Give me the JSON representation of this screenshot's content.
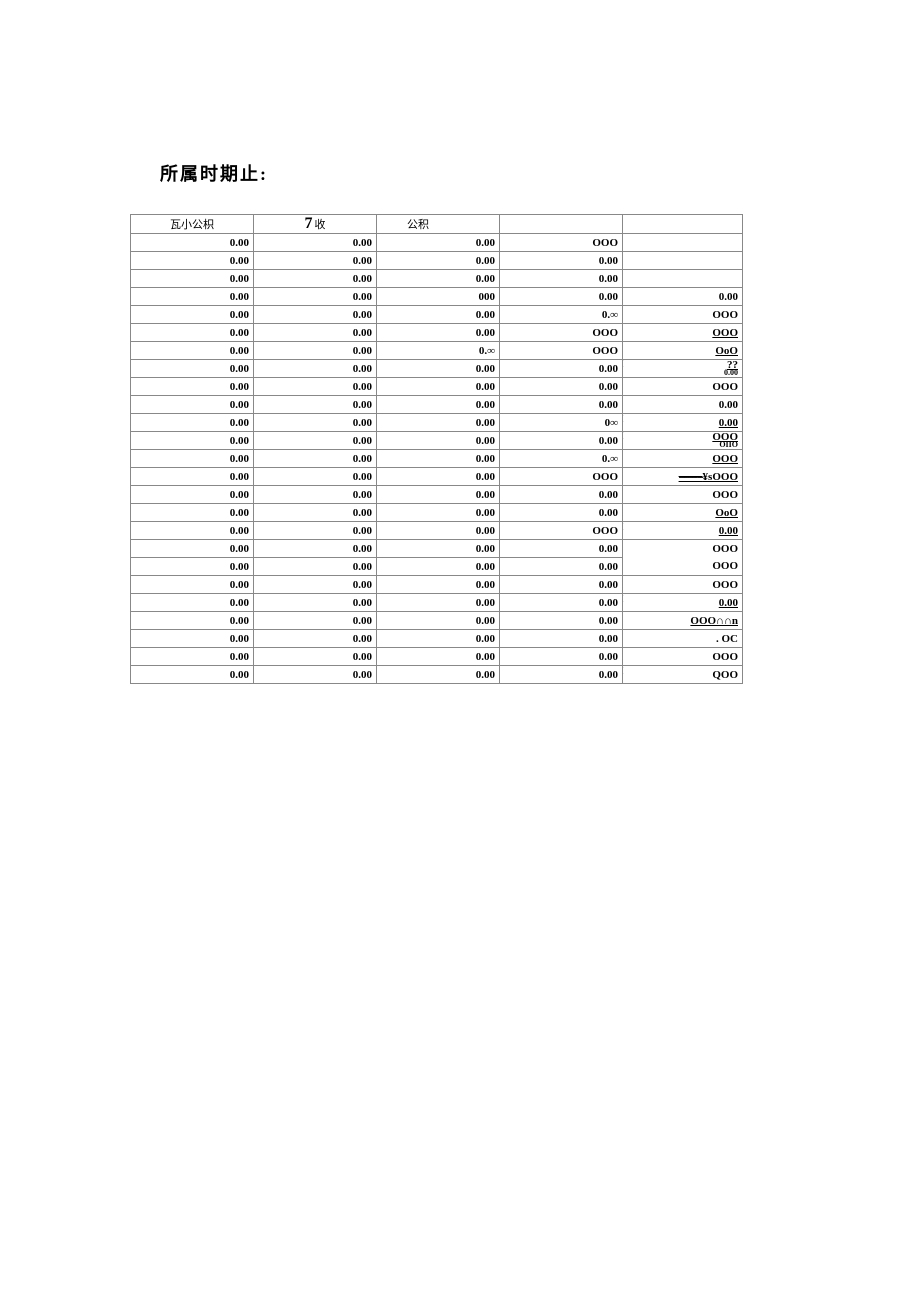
{
  "title": "所属时期止:",
  "headers": [
    "瓦小公枳",
    "7",
    "收",
    "公积",
    "",
    ""
  ],
  "rows": [
    [
      "0.00",
      "0.00",
      "0.00",
      "OOO",
      ""
    ],
    [
      "0.00",
      "0.00",
      "0.00",
      "0.00",
      ""
    ],
    [
      "0.00",
      "0.00",
      "0.00",
      "0.00",
      ""
    ],
    [
      "0.00",
      "0.00",
      "000",
      "0.00",
      "0.00"
    ],
    [
      "0.00",
      "0.00",
      "0.00",
      "0.∞",
      "OOO"
    ],
    [
      "0.00",
      "0.00",
      "0.00",
      "OOO",
      "OOO"
    ],
    [
      "0.00",
      "0.00",
      "0.∞",
      "OOO",
      "OoO"
    ],
    [
      "0.00",
      "0.00",
      "0.00",
      "0.00",
      "??"
    ],
    [
      "0.00",
      "0.00",
      "0.00",
      "0.00",
      "OOO"
    ],
    [
      "0.00",
      "0.00",
      "0.00",
      "0.00",
      "0.00"
    ],
    [
      "0.00",
      "0.00",
      "0.00",
      "0∞",
      "0.00"
    ],
    [
      "0.00",
      "0.00",
      "0.00",
      "0.00",
      "OOO"
    ],
    [
      "0.00",
      "0.00",
      "0.00",
      "0.∞",
      "OOO"
    ],
    [
      "0.00",
      "0.00",
      "0.00",
      "OOO",
      "¥sOOO"
    ],
    [
      "0.00",
      "0.00",
      "0.00",
      "0.00",
      "OOO"
    ],
    [
      "0.00",
      "0.00",
      "0.00",
      "0.00",
      "OoO"
    ],
    [
      "0.00",
      "0.00",
      "0.00",
      "OOO",
      "0.00"
    ],
    [
      "0.00",
      "0.00",
      "0.00",
      "0.00",
      "OOO"
    ],
    [
      "0.00",
      "0.00",
      "0.00",
      "0.00",
      "OOO"
    ],
    [
      "0.00",
      "0.00",
      "0.00",
      "0.00",
      "OOO"
    ],
    [
      "0.00",
      "0.00",
      "0.00",
      "0.00",
      "0.00"
    ],
    [
      "0.00",
      "0.00",
      "0.00",
      "0.00",
      "OOO∩∩n"
    ],
    [
      "0.00",
      "0.00",
      "0.00",
      "0.00",
      ". OC"
    ],
    [
      "0.00",
      "0.00",
      "0.00",
      "0.00",
      "OOO"
    ],
    [
      "0.00",
      "0.00",
      "0.00",
      "0.00",
      "QOO"
    ]
  ],
  "annot": {
    "r7": "I",
    "r10": "I",
    "r11": "I",
    "r16b": "I",
    "r20": "I",
    "r24": "I"
  },
  "extra": {
    "r7_sub": "0.00",
    "r11_sub": "OIIO"
  }
}
